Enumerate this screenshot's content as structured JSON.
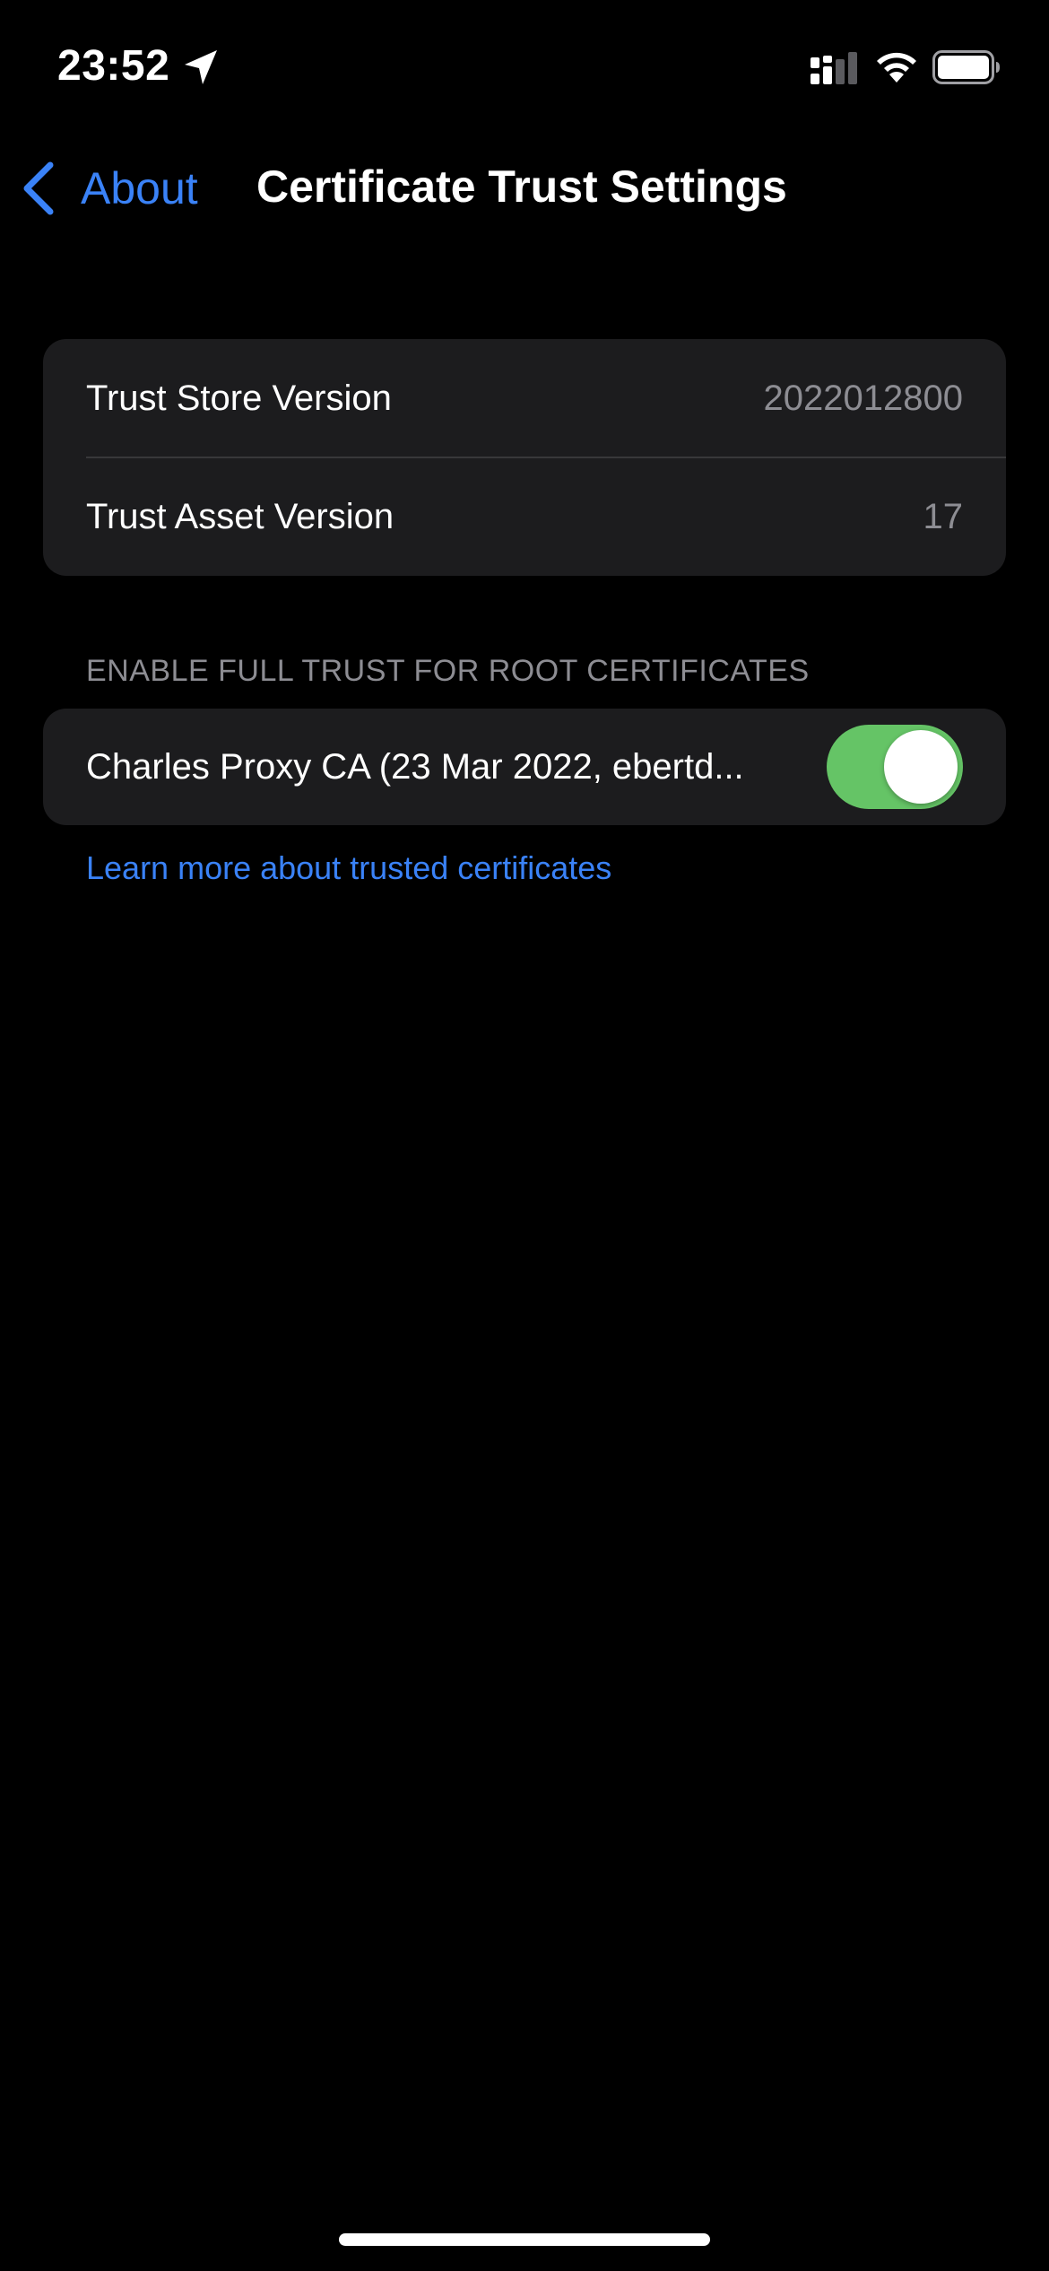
{
  "status_bar": {
    "time": "23:52",
    "icons": [
      "location-arrow-icon",
      "cellular-signal-icon",
      "wifi-icon",
      "battery-icon"
    ]
  },
  "nav": {
    "back_label": "About",
    "title": "Certificate Trust Settings"
  },
  "versions": [
    {
      "label": "Trust Store Version",
      "value": "2022012800"
    },
    {
      "label": "Trust Asset Version",
      "value": "17"
    }
  ],
  "trust_section": {
    "header": "ENABLE FULL TRUST FOR ROOT CERTIFICATES",
    "certificates": [
      {
        "label": "Charles Proxy CA (23 Mar 2022, ebertd...",
        "enabled": true
      }
    ],
    "learn_more": "Learn more about trusted certificates"
  },
  "colors": {
    "accent": "#3a82f7",
    "toggle_on": "#65c466",
    "cell_background": "#1c1c1e",
    "secondary_text": "#8d8d93"
  }
}
